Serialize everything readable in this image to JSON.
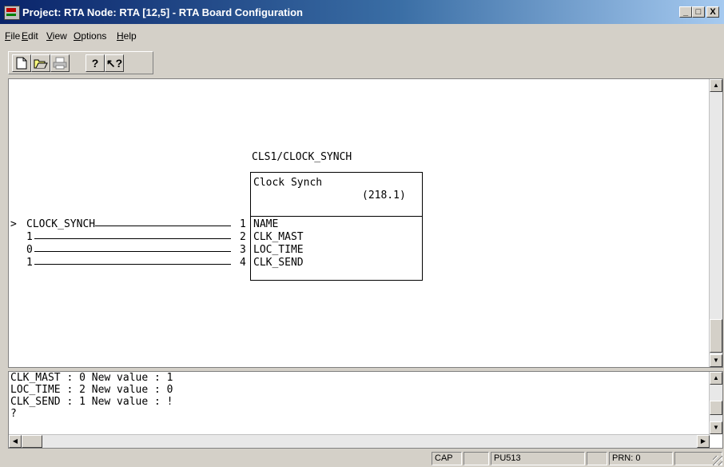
{
  "window": {
    "title": "Project: RTA  Node: RTA  [12,5] - RTA Board Configuration",
    "minimize": "_",
    "maximize": "□",
    "close": "X"
  },
  "menu": {
    "items": [
      {
        "label_u": "F",
        "label_rest": "ile"
      },
      {
        "label_u": "E",
        "label_rest": "dit"
      },
      {
        "label_u": "V",
        "label_rest": "iew"
      },
      {
        "label_u": "O",
        "label_rest": "ptions"
      },
      {
        "label_u": "H",
        "label_rest": "elp"
      }
    ]
  },
  "toolbar": {
    "icons": [
      "new-document-icon",
      "open-folder-icon",
      "print-icon",
      "help-icon",
      "context-help-icon"
    ],
    "help_glyph": "?",
    "context_help_glyph": "↖?"
  },
  "diagram": {
    "instance_label": "CLS1/CLOCK_SYNCH",
    "block_title": "Clock Synch",
    "block_number": "(218.1)",
    "marker": ">",
    "inputs": [
      {
        "value": "CLOCK_SYNCH",
        "pin": "1",
        "name": "NAME"
      },
      {
        "value": "1",
        "pin": "2",
        "name": "CLK_MAST"
      },
      {
        "value": "0",
        "pin": "3",
        "name": "LOC_TIME"
      },
      {
        "value": "1",
        "pin": "4",
        "name": "CLK_SEND"
      }
    ]
  },
  "console": {
    "lines": [
      "CLK_MAST : 0 New value : 1",
      "LOC_TIME : 2 New value : 0",
      "CLK_SEND : 1 New value : !",
      "?"
    ]
  },
  "status": {
    "cap": "CAP",
    "unit": "PU513",
    "prn": "PRN:  0"
  }
}
